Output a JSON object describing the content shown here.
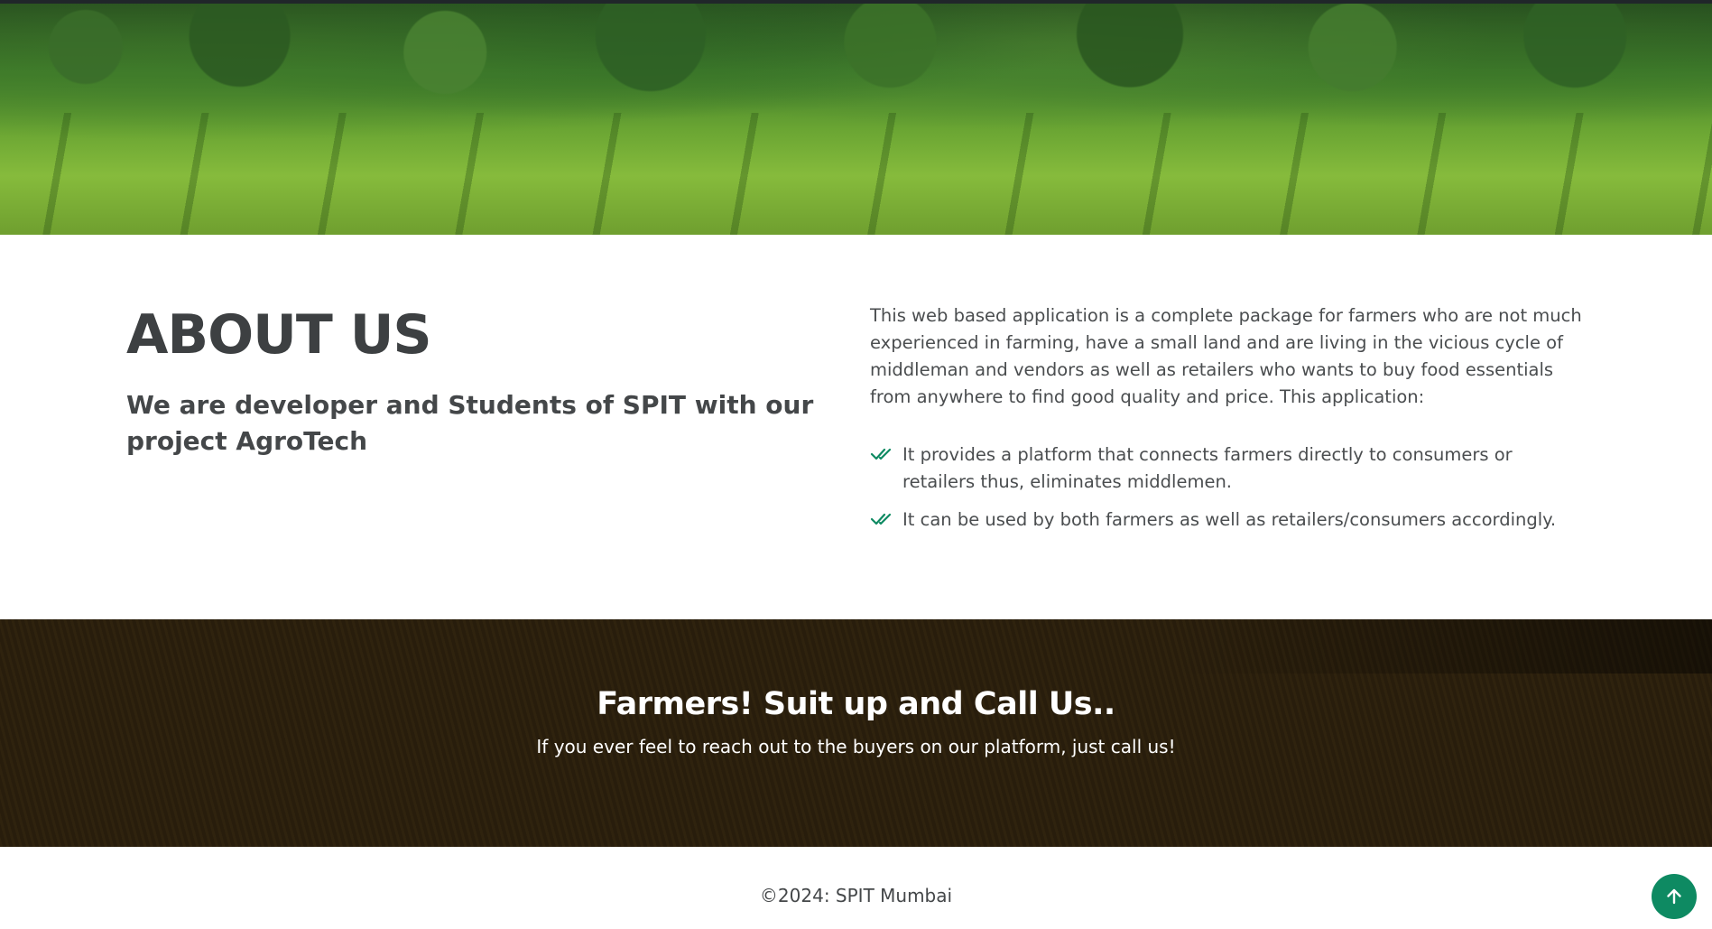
{
  "about": {
    "title": "ABOUT US",
    "subtitle": "We are developer and Students of SPIT with our project AgroTech",
    "description": "This web based application is a complete package for farmers who are not much experienced in farming, have a small land and are living in the vicious cycle of middleman and vendors as well as retailers who wants to buy food essentials from anywhere to find good quality and price. This application:",
    "points": [
      "It provides a platform that connects farmers directly to consumers or retailers thus, eliminates middlemen.",
      "It can be used by both farmers as well as retailers/consumers accordingly."
    ],
    "check_icon": "double-check-icon",
    "accent_color": "#0e8a62"
  },
  "cta": {
    "title": "Farmers! Suit up and Call Us..",
    "text": "If you ever feel to reach out to the buyers on our platform, just call us!"
  },
  "footer": {
    "copyright": "©2024: SPIT Mumbai"
  },
  "back_to_top": {
    "icon": "arrow-up-icon",
    "color": "#0e8a62"
  }
}
